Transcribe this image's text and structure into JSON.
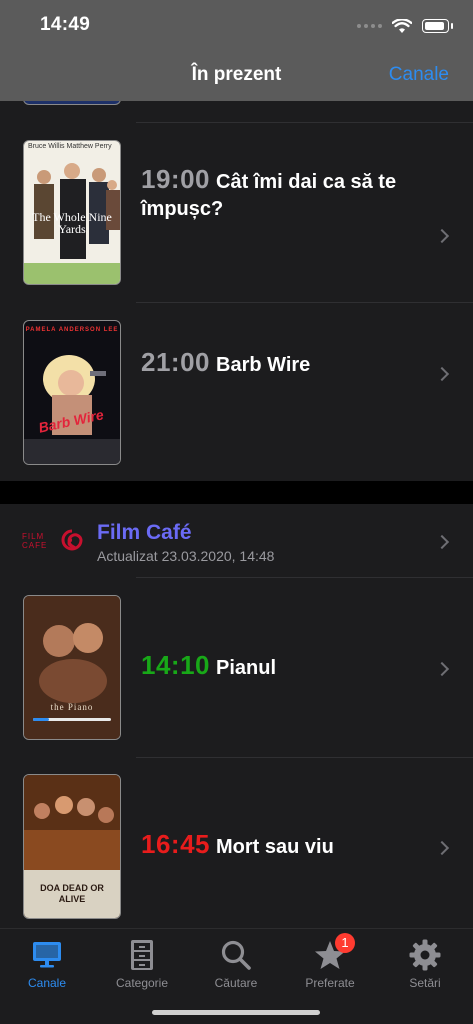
{
  "status": {
    "time": "14:49"
  },
  "nav": {
    "title": "În prezent",
    "action": "Canale"
  },
  "colors": {
    "accent": "#2d8cf0",
    "channel": "#6b6bf5",
    "past": "#a0a0a5",
    "live": "#18a818",
    "upcoming": "#e81c1c",
    "badge": "#ff3b30"
  },
  "channel1": {
    "shows": [
      {
        "time": "19:00",
        "title": "Cât îmi dai ca să te împușc?",
        "poster": "The Whole Nine Yards",
        "poster_credits": "Bruce Willis   Matthew Perry"
      },
      {
        "time": "21:00",
        "title": "Barb Wire",
        "poster": "Barb Wire",
        "poster_credits": "PAMELA ANDERSON LEE"
      }
    ]
  },
  "channel2": {
    "name": "Film Café",
    "logo": "FILM CAFE",
    "updated": "Actualizat 23.03.2020, 14:48",
    "shows": [
      {
        "time": "14:10",
        "title": "Pianul",
        "poster": "the Piano",
        "progress": 0.2
      },
      {
        "time": "16:45",
        "title": "Mort sau viu",
        "poster": "DOA DEAD OR ALIVE"
      }
    ]
  },
  "tabs": [
    {
      "label": "Canale",
      "icon": "tv-icon",
      "active": true
    },
    {
      "label": "Categorie",
      "icon": "cabinet-icon"
    },
    {
      "label": "Căutare",
      "icon": "search-icon"
    },
    {
      "label": "Preferate",
      "icon": "star-icon",
      "badge": "1"
    },
    {
      "label": "Setări",
      "icon": "gear-icon"
    }
  ]
}
